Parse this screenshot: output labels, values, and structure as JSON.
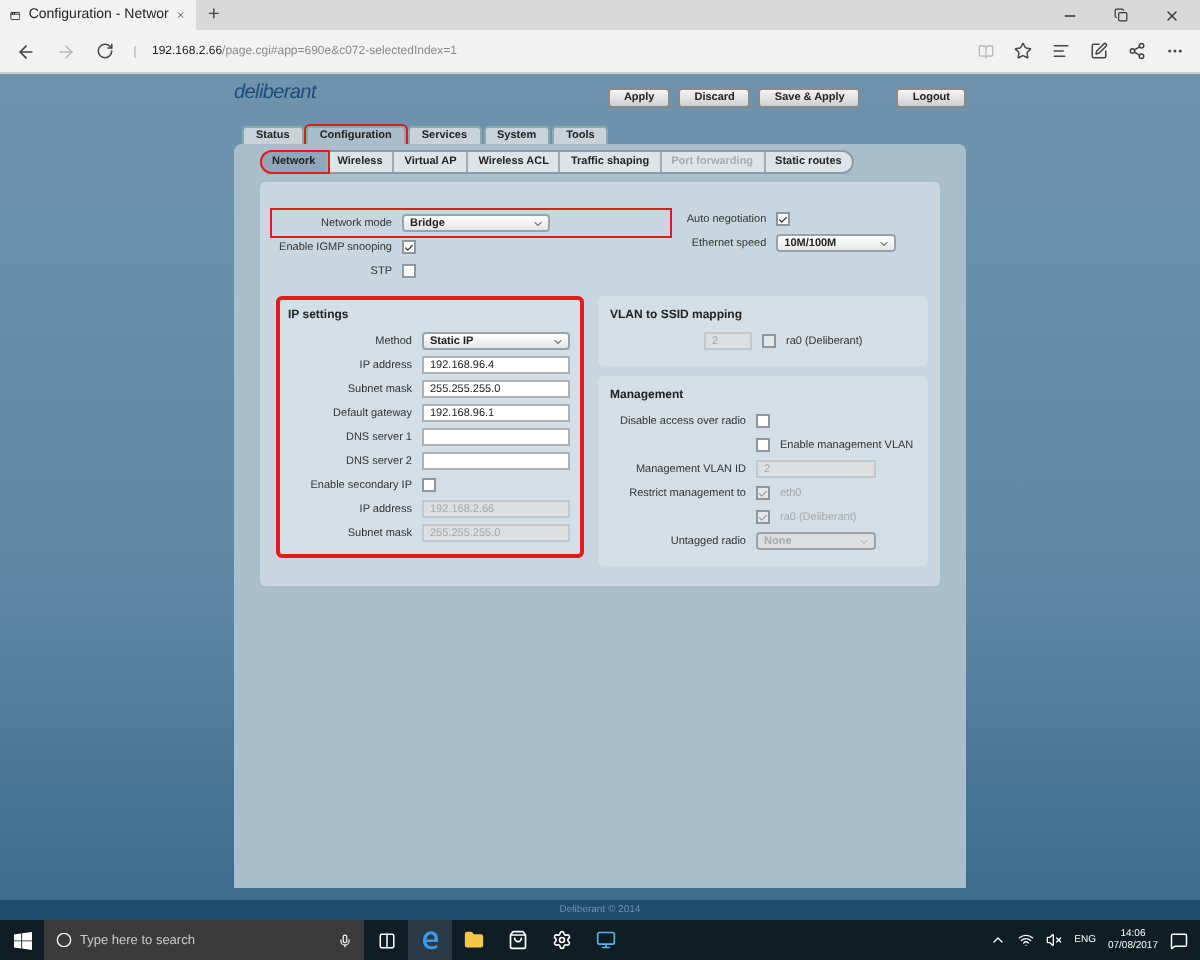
{
  "browser": {
    "tab_title": "Configuration - Networ",
    "new_tab": "+",
    "url_host": "192.168.2.66",
    "url_path": "/page.cgi#app=690e&c072-selectedIndex=1"
  },
  "header": {
    "logo": "deliberant",
    "buttons": [
      {
        "label": "Apply"
      },
      {
        "label": "Discard"
      },
      {
        "label": "Save & Apply"
      },
      {
        "label": "Logout"
      }
    ]
  },
  "tabs": [
    {
      "label": "Status",
      "selected": false,
      "highlighted": false
    },
    {
      "label": "Configuration",
      "selected": true,
      "highlighted": true
    },
    {
      "label": "Services",
      "selected": false,
      "highlighted": false
    },
    {
      "label": "System",
      "selected": false,
      "highlighted": false
    },
    {
      "label": "Tools",
      "selected": false,
      "highlighted": false
    }
  ],
  "subtabs": [
    {
      "label": "Network",
      "selected": true,
      "disabled": false,
      "highlighted": true
    },
    {
      "label": "Wireless",
      "selected": false,
      "disabled": false,
      "highlighted": false
    },
    {
      "label": "Virtual AP",
      "selected": false,
      "disabled": false,
      "highlighted": false
    },
    {
      "label": "Wireless ACL",
      "selected": false,
      "disabled": false,
      "highlighted": false
    },
    {
      "label": "Traffic shaping",
      "selected": false,
      "disabled": false,
      "highlighted": false
    },
    {
      "label": "Port forwarding",
      "selected": false,
      "disabled": true,
      "highlighted": false
    },
    {
      "label": "Static routes",
      "selected": false,
      "disabled": false,
      "highlighted": false
    }
  ],
  "general_left": [
    {
      "kind": "select",
      "label": "Network mode",
      "value": "Bridge",
      "disabled": false,
      "highlighted": true
    },
    {
      "kind": "checkbox",
      "label": "Enable IGMP snooping",
      "checked": true,
      "disabled": false
    },
    {
      "kind": "checkbox",
      "label": "STP",
      "checked": false,
      "disabled": false
    }
  ],
  "general_right": [
    {
      "kind": "checkbox",
      "label": "Auto negotiation",
      "checked": true,
      "disabled": false
    },
    {
      "kind": "select",
      "label": "Ethernet speed",
      "value": "10M/100M",
      "disabled": false
    }
  ],
  "ip_settings": {
    "title": "IP settings",
    "highlighted": true,
    "rows": [
      {
        "kind": "select",
        "label": "Method",
        "value": "Static IP",
        "disabled": false
      },
      {
        "kind": "input",
        "label": "IP address",
        "value": "192.168.96.4",
        "disabled": false
      },
      {
        "kind": "input",
        "label": "Subnet mask",
        "value": "255.255.255.0",
        "disabled": false
      },
      {
        "kind": "input",
        "label": "Default gateway",
        "value": "192.168.96.1",
        "disabled": false
      },
      {
        "kind": "input",
        "label": "DNS server 1",
        "disabled": false
      },
      {
        "kind": "input",
        "label": "DNS server 2",
        "disabled": false
      },
      {
        "kind": "checkbox",
        "label": "Enable secondary IP",
        "checked": false,
        "disabled": false
      },
      {
        "kind": "input",
        "label": "IP address",
        "value": "192.168.2.66",
        "disabled": true
      },
      {
        "kind": "input",
        "label": "Subnet mask",
        "value": "255.255.255.0",
        "disabled": true
      }
    ]
  },
  "vlan_mapping": {
    "title": "VLAN to SSID mapping",
    "rows": [
      {
        "kind": "input_checkbox",
        "value": "2",
        "option": "ra0 (Deliberant)",
        "checked": false,
        "disabled": true
      }
    ]
  },
  "management": {
    "title": "Management",
    "rows": [
      {
        "kind": "checkbox",
        "label": "Disable access over radio",
        "checked": false,
        "disabled": false
      },
      {
        "kind": "checkbox",
        "option": "Enable management VLAN",
        "checked": false,
        "disabled": false
      },
      {
        "kind": "input",
        "label": "Management VLAN ID",
        "value": "2",
        "disabled": true
      },
      {
        "kind": "checkbox",
        "label": "Restrict management to",
        "option": "eth0",
        "checked": true,
        "disabled": true
      },
      {
        "kind": "checkbox",
        "option": "ra0 (Deliberant)",
        "checked": true,
        "disabled": true
      },
      {
        "kind": "select",
        "label": "Untagged radio",
        "value": "None",
        "disabled": true
      }
    ]
  },
  "footer": "Deliberant © 2014",
  "taskbar": {
    "search_placeholder": "Type here to search",
    "language": "ENG",
    "time": "14:06",
    "date": "07/08/2017"
  }
}
